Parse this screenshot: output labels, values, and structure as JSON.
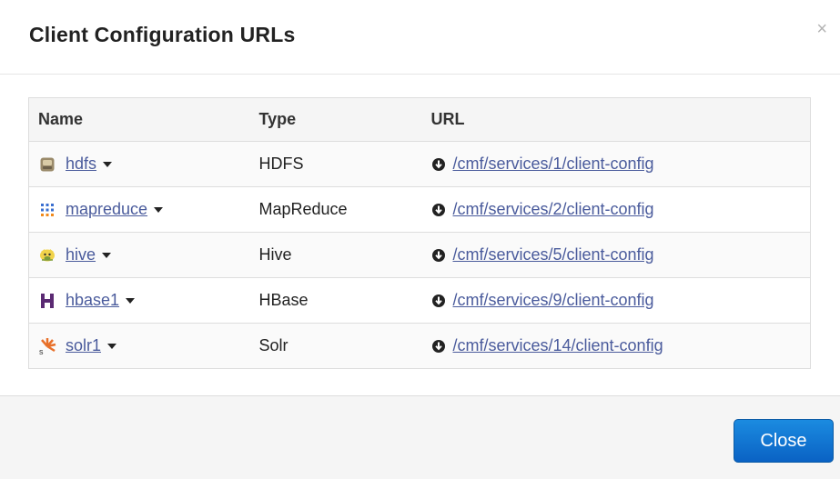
{
  "dialog": {
    "title": "Client Configuration URLs",
    "close_x": "×"
  },
  "table": {
    "headers": {
      "name": "Name",
      "type": "Type",
      "url": "URL"
    },
    "rows": [
      {
        "name": "hdfs",
        "type": "HDFS",
        "url": "/cmf/services/1/client-config",
        "icon": "hdfs-icon"
      },
      {
        "name": "mapreduce",
        "type": "MapReduce",
        "url": "/cmf/services/2/client-config",
        "icon": "mapreduce-icon"
      },
      {
        "name": "hive",
        "type": "Hive",
        "url": "/cmf/services/5/client-config",
        "icon": "hive-icon"
      },
      {
        "name": "hbase1",
        "type": "HBase",
        "url": "/cmf/services/9/client-config",
        "icon": "hbase-icon"
      },
      {
        "name": "solr1",
        "type": "Solr",
        "url": "/cmf/services/14/client-config",
        "icon": "solr-icon"
      }
    ]
  },
  "footer": {
    "close_label": "Close"
  },
  "colors": {
    "link": "#4a5b9c",
    "button": "#0a62c4"
  }
}
